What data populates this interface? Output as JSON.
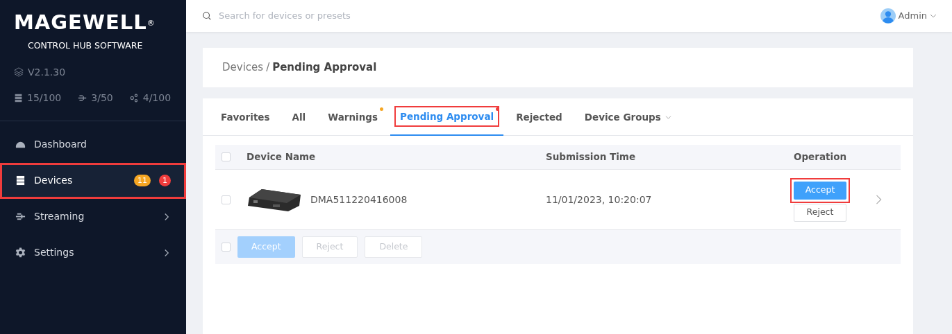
{
  "sidebar": {
    "logo": "MAGEWELL",
    "logo_mark": "®",
    "subtitle": "CONTROL HUB SOFTWARE",
    "version": "V2.1.30",
    "stats": [
      {
        "kind": "devices",
        "text": "15/100"
      },
      {
        "kind": "streams",
        "text": "3/50"
      },
      {
        "kind": "nodes",
        "text": "4/100"
      }
    ],
    "items": [
      {
        "kind": "dashboard",
        "label": "Dashboard",
        "selected": false,
        "highlighted": false,
        "expandable": false
      },
      {
        "kind": "devices",
        "label": "Devices",
        "selected": true,
        "highlighted": true,
        "expandable": false,
        "badges": [
          {
            "text": "11",
            "color": "#f5a623"
          },
          {
            "text": "1",
            "color": "#f03c3c"
          }
        ]
      },
      {
        "kind": "streaming",
        "label": "Streaming",
        "selected": false,
        "highlighted": false,
        "expandable": true
      },
      {
        "kind": "settings",
        "label": "Settings",
        "selected": false,
        "highlighted": false,
        "expandable": true
      }
    ]
  },
  "topbar": {
    "search": {
      "placeholder": "Search for devices or presets"
    },
    "user": "Admin"
  },
  "breadcrumb": {
    "parent": "Devices",
    "separator": "/",
    "current": "Pending Approval"
  },
  "tabs": [
    {
      "label": "Favorites",
      "selected": false,
      "highlighted": false,
      "dropdown": false
    },
    {
      "label": "All",
      "selected": false,
      "highlighted": false,
      "dropdown": false
    },
    {
      "label": "Warnings",
      "selected": false,
      "highlighted": false,
      "dropdown": false,
      "color": "#f5a623"
    },
    {
      "label": "Pending Approval",
      "selected": true,
      "highlighted": true,
      "dropdown": false,
      "color": "#f03c3c"
    },
    {
      "label": "Rejected",
      "selected": false,
      "highlighted": false,
      "dropdown": false
    },
    {
      "label": "Device Groups",
      "selected": false,
      "highlighted": false,
      "dropdown": true
    }
  ],
  "table": {
    "header_checked": false,
    "columns": [
      "Device Name",
      "Submission Time",
      "Operation"
    ],
    "rows": [
      {
        "checked": false,
        "name": "DMA511220416008",
        "time": "11/01/2023, 10:20:07",
        "accept": "Accept",
        "reject": "Reject",
        "accept_highlighted": true
      }
    ],
    "footer": {
      "checked": false,
      "buttons": [
        {
          "kind": "primary",
          "label": "Accept",
          "disabled": true
        },
        {
          "kind": "plain",
          "label": "Reject",
          "disabled": true
        },
        {
          "kind": "plain",
          "label": "Delete",
          "disabled": true
        }
      ]
    }
  }
}
